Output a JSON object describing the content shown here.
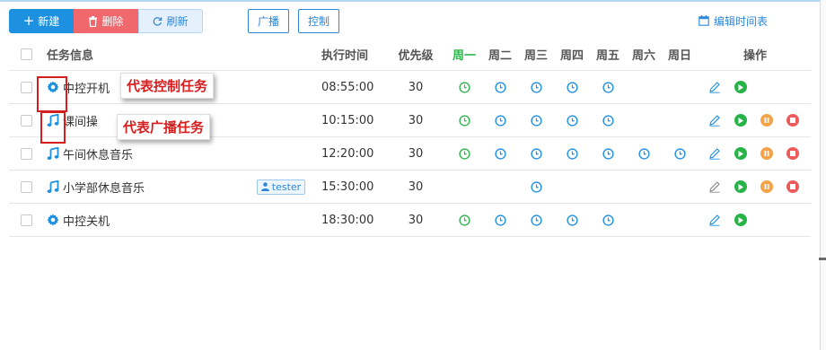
{
  "toolbar": {
    "new_label": "新建",
    "delete_label": "删除",
    "refresh_label": "刷新",
    "broadcast_label": "广播",
    "control_label": "控制",
    "edit_schedule_label": "编辑时间表"
  },
  "table": {
    "headers": {
      "name": "任务信息",
      "time": "执行时间",
      "priority": "优先级",
      "days": [
        "周一",
        "周二",
        "周三",
        "周四",
        "周五",
        "周六",
        "周日"
      ],
      "ops": "操作"
    },
    "rows": [
      {
        "type": "control",
        "name": "中控开机",
        "tag": "",
        "time": "08:55:00",
        "priority": "30",
        "days": [
          true,
          true,
          true,
          true,
          true,
          false,
          false
        ],
        "pause_stop": false
      },
      {
        "type": "broadcast",
        "name": "课间操",
        "tag": "",
        "time": "10:15:00",
        "priority": "30",
        "days": [
          true,
          true,
          true,
          true,
          true,
          false,
          false
        ],
        "pause_stop": true
      },
      {
        "type": "broadcast",
        "name": "午间休息音乐",
        "tag": "",
        "time": "12:20:00",
        "priority": "30",
        "days": [
          true,
          true,
          true,
          true,
          true,
          true,
          true
        ],
        "pause_stop": true
      },
      {
        "type": "broadcast",
        "name": "小学部休息音乐",
        "tag": "tester",
        "time": "15:30:00",
        "priority": "30",
        "days": [
          false,
          false,
          true,
          false,
          false,
          false,
          false
        ],
        "pause_stop": true
      },
      {
        "type": "control",
        "name": "中控关机",
        "tag": "",
        "time": "18:30:00",
        "priority": "30",
        "days": [
          true,
          true,
          true,
          true,
          true,
          false,
          false
        ],
        "pause_stop": false
      }
    ]
  },
  "annotations": {
    "control_label": "代表控制任务",
    "broadcast_label": "代表广播任务"
  },
  "colors": {
    "primary": "#1e90e0",
    "danger": "#f0686c",
    "active_day": "#2fb34d",
    "play": "#27b348",
    "pause": "#f5a34a",
    "stop": "#ec5a5a",
    "annotation": "#d61e1e"
  },
  "icons": {
    "control": "gear-icon",
    "broadcast": "music-note-icon",
    "schedule_day": "clock-icon"
  }
}
